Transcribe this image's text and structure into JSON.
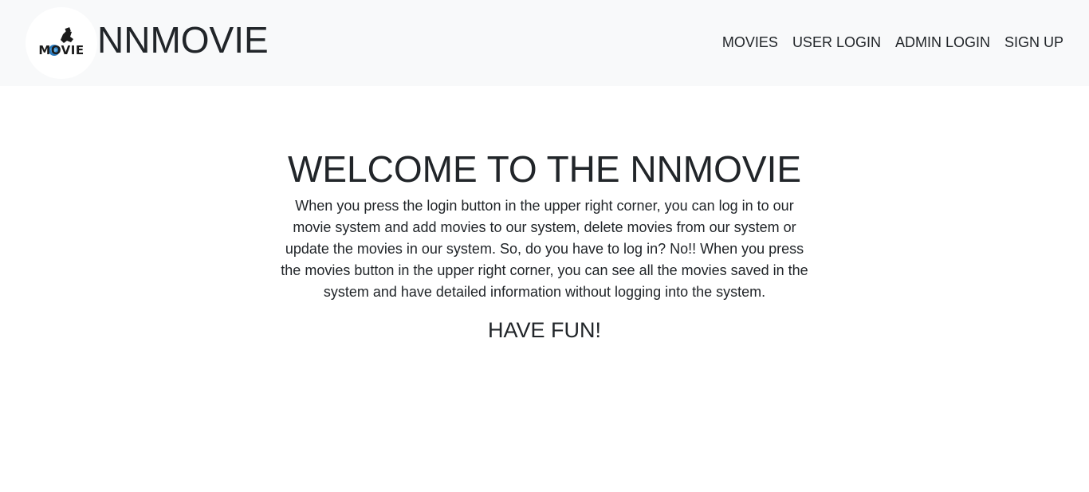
{
  "navbar": {
    "logo_text": "MOVIE",
    "brand_name": "NNMOVIE",
    "links": [
      {
        "label": "MOVIES"
      },
      {
        "label": "USER LOGIN"
      },
      {
        "label": "ADMIN LOGIN"
      },
      {
        "label": "SIGN UP"
      }
    ]
  },
  "main": {
    "title": "WELCOME TO THE NNMOVIE",
    "description": "When you press the login button in the upper right corner, you can log in to our movie system and add movies to our system, delete movies from our system or update the movies in our system. So, do you have to log in? No!! When you press the movies button in the upper right corner, you can see all the movies saved in the system and have detailed information without logging into the system.",
    "tagline": "HAVE FUN!"
  },
  "colors": {
    "navbar_bg": "#f8f9fa",
    "text": "#212529",
    "logo_globe": "#2b7bbf"
  }
}
